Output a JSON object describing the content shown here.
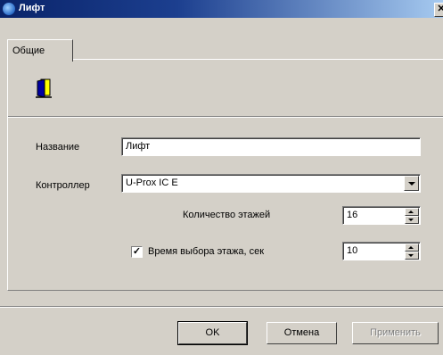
{
  "window": {
    "title": "Лифт",
    "close_glyph": "✕",
    "icon": "app-globe-icon"
  },
  "tabs": [
    {
      "label": "Общие",
      "active": true
    }
  ],
  "header_icon": "door-icon",
  "form": {
    "name_label": "Название",
    "name_value": "Лифт",
    "controller_label": "Контроллер",
    "controller_value": "U-Prox IC E",
    "floors_label": "Количество этажей",
    "floors_value": "16",
    "floor_time_label": "Время выбора этажа, сек",
    "floor_time_checked": true,
    "floor_time_value": "10"
  },
  "buttons": {
    "ok": "OK",
    "cancel": "Отмена",
    "apply": "Применить"
  }
}
